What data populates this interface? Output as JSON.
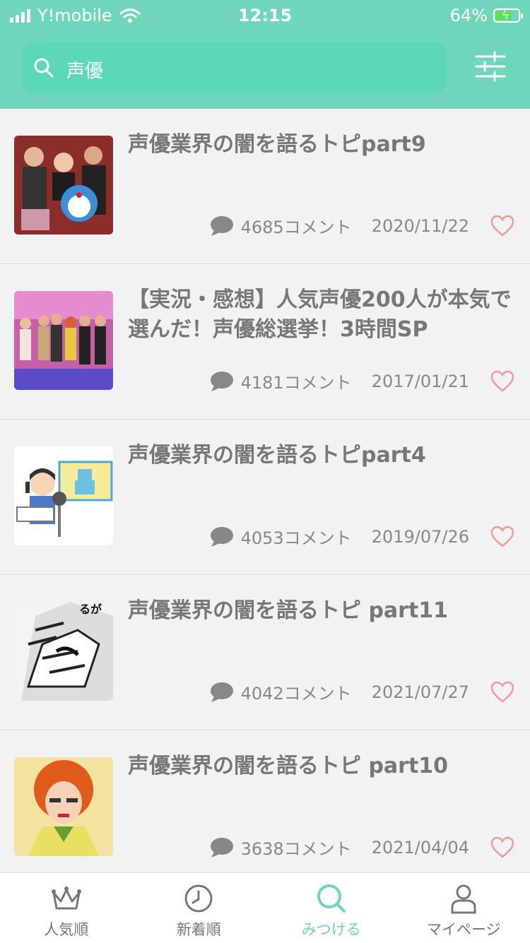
{
  "status_bar": {
    "carrier": "Y!mobile",
    "time": "12:15",
    "battery": "64%"
  },
  "search": {
    "query": "声優"
  },
  "topics": [
    {
      "title": "声優業界の闇を語るトピpart9",
      "comments": "4685コメント",
      "date": "2020/11/22"
    },
    {
      "title": "【実況・感想】人気声優200人が本気で選んだ！声優総選挙！3時間SP",
      "comments": "4181コメント",
      "date": "2017/01/21"
    },
    {
      "title": "声優業界の闇を語るトピpart4",
      "comments": "4053コメント",
      "date": "2019/07/26"
    },
    {
      "title": "声優業界の闇を語るトピ part11",
      "comments": "4042コメント",
      "date": "2021/07/27"
    },
    {
      "title": "声優業界の闇を語るトピ part10",
      "comments": "3638コメント",
      "date": "2021/04/04"
    }
  ],
  "tabs": [
    {
      "label": "人気順",
      "icon": "crown-icon"
    },
    {
      "label": "新着順",
      "icon": "clock-icon"
    },
    {
      "label": "みつける",
      "icon": "search-icon",
      "active": true
    },
    {
      "label": "マイページ",
      "icon": "person-icon"
    }
  ],
  "colors": {
    "header": "#6fd5bb",
    "search_box": "#5cd8b8",
    "heart": "#f29a9a",
    "active_tab": "#6fd5bb"
  }
}
